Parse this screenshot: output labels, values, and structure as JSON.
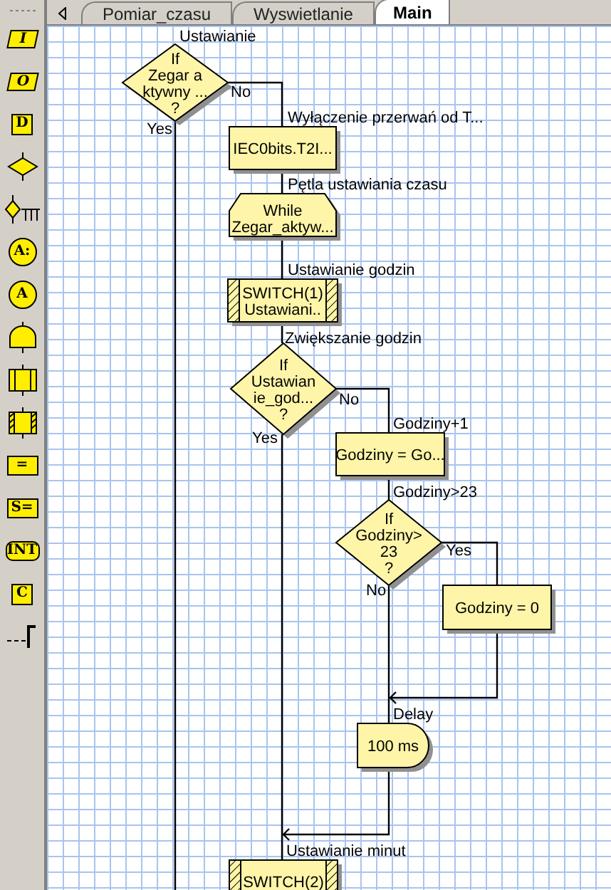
{
  "toolbar": [
    {
      "kind": "input",
      "label": "I"
    },
    {
      "kind": "output",
      "label": "O"
    },
    {
      "kind": "data",
      "label": "D"
    },
    {
      "kind": "decision"
    },
    {
      "kind": "select"
    },
    {
      "kind": "label",
      "label": "A:"
    },
    {
      "kind": "goto",
      "label": "A"
    },
    {
      "kind": "delay"
    },
    {
      "kind": "subroutine"
    },
    {
      "kind": "switch"
    },
    {
      "kind": "assign",
      "label": "="
    },
    {
      "kind": "assign",
      "label": "S="
    },
    {
      "kind": "interrupt",
      "label": "INT"
    },
    {
      "kind": "code",
      "label": "C"
    },
    {
      "kind": "comment"
    }
  ],
  "tabs": [
    {
      "label": "Pomiar_czasu",
      "selected": false
    },
    {
      "label": "Wyswietlanie",
      "selected": false
    },
    {
      "label": "Main",
      "selected": true
    }
  ],
  "flowchart": {
    "nodes": [
      {
        "kind": "decision",
        "caption": "Ustawianie",
        "lines": [
          "If",
          "Zegar a",
          "ktywny ...",
          "?"
        ],
        "yes": "Yes",
        "no": "No"
      },
      {
        "kind": "process",
        "caption": "Wyłączenie przerwań od T...",
        "lines": [
          "IEC0bits.T2I..."
        ]
      },
      {
        "kind": "loop",
        "caption": "Pętla ustawiania czasu",
        "lines": [
          "While",
          "Zegar_aktyw..."
        ]
      },
      {
        "kind": "switch",
        "caption": "Ustawianie godzin",
        "lines": [
          "SWITCH(1)",
          "Ustawiani.."
        ]
      },
      {
        "kind": "decision",
        "caption": "Zwiększanie godzin",
        "lines": [
          "If",
          "Ustawian",
          "ie_god...",
          "?"
        ],
        "yes": "Yes",
        "no": "No"
      },
      {
        "kind": "process",
        "caption": "Godziny+1",
        "lines": [
          "Godziny = Go..."
        ]
      },
      {
        "kind": "decision",
        "caption": "Godziny>23",
        "lines": [
          "If",
          "Godziny>",
          "23",
          "?"
        ],
        "yes": "Yes",
        "no": "No"
      },
      {
        "kind": "process",
        "lines": [
          "Godziny = 0"
        ]
      },
      {
        "kind": "delay",
        "caption": "Delay",
        "lines": [
          "100 ms"
        ]
      },
      {
        "kind": "switch",
        "caption": "Ustawianie minut",
        "lines": [
          "SWITCH(2)"
        ]
      }
    ]
  }
}
